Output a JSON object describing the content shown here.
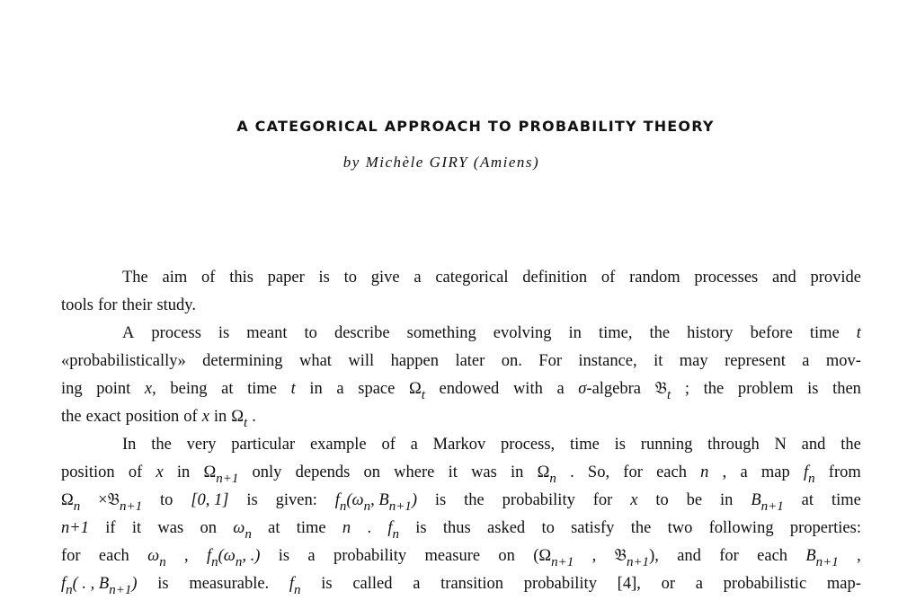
{
  "title": "A CATEGORICAL APPROACH TO PROBABILITY THEORY",
  "author": "by Michèle GIRY (Amiens)",
  "lines": [
    {
      "indent": true,
      "segs": [
        "The aim of this paper is to give a categorical definition of random processes and provide"
      ]
    },
    {
      "last": true,
      "segs": [
        "tools for their study."
      ]
    },
    {
      "indent": true,
      "segs": [
        "A process is meant to describe something evolving in time, the history before time ",
        [
          "i",
          "t"
        ]
      ]
    },
    {
      "segs": [
        "«probabilistically» determining what will happen later on. For instance, it may represent a mov-"
      ]
    },
    {
      "segs": [
        "ing point ",
        [
          "i",
          "x"
        ],
        ", being at time ",
        [
          "i",
          "t"
        ],
        " in a space Ω",
        [
          "s",
          "t"
        ],
        " endowed with a ",
        [
          "i",
          "σ"
        ],
        "-algebra 𝔅",
        [
          "s",
          "t"
        ],
        " ; the problem is then"
      ]
    },
    {
      "last": true,
      "segs": [
        "the exact position of ",
        [
          "i",
          "x"
        ],
        " in Ω",
        [
          "s",
          "t"
        ],
        " ."
      ]
    },
    {
      "indent": true,
      "segs": [
        "In the very particular example of a Markov process, time is running through N and the"
      ]
    },
    {
      "segs": [
        "position of ",
        [
          "i",
          "x"
        ],
        " in Ω",
        [
          "s",
          "n+1"
        ],
        " only depends on where it was in Ω",
        [
          "s",
          "n"
        ],
        " . So, for each ",
        [
          "i",
          "n"
        ],
        " , a map ",
        [
          "i",
          "f"
        ],
        [
          "s",
          "n"
        ],
        " from"
      ]
    },
    {
      "segs": [
        "Ω",
        [
          "s",
          "n"
        ],
        " ×𝔅",
        [
          "s",
          "n+1"
        ],
        " to ",
        [
          "i",
          "[0, 1]"
        ],
        " is given: ",
        [
          "i",
          "f"
        ],
        [
          "s",
          "n"
        ],
        [
          "i",
          "(ω"
        ],
        [
          "s",
          "n"
        ],
        [
          "i",
          ", B"
        ],
        [
          "s",
          "n+1"
        ],
        [
          "i",
          ")"
        ],
        " is the probability for ",
        [
          "i",
          "x"
        ],
        " to be in ",
        [
          "i",
          "B"
        ],
        [
          "s",
          "n+1"
        ],
        " at time"
      ]
    },
    {
      "segs": [
        [
          "i",
          "n+1"
        ],
        " if it was on ",
        [
          "i",
          "ω"
        ],
        [
          "s",
          "n"
        ],
        " at time ",
        [
          "i",
          "n"
        ],
        " . ",
        [
          "i",
          "f"
        ],
        [
          "s",
          "n"
        ],
        " is thus asked to satisfy the two following properties:"
      ]
    },
    {
      "segs": [
        "for each ",
        [
          "i",
          "ω"
        ],
        [
          "s",
          "n"
        ],
        " , ",
        [
          "i",
          "f"
        ],
        [
          "s",
          "n"
        ],
        [
          "i",
          "(ω"
        ],
        [
          "s",
          "n"
        ],
        [
          "i",
          ", .)"
        ],
        " is a probability measure on (Ω",
        [
          "s",
          "n+1"
        ],
        " , 𝔅",
        [
          "s",
          "n+1"
        ],
        "), and for each ",
        [
          "i",
          "B"
        ],
        [
          "s",
          "n+1"
        ],
        " ,"
      ]
    },
    {
      "segs": [
        [
          "i",
          "f"
        ],
        [
          "s",
          "n"
        ],
        [
          "i",
          "( . , B"
        ],
        [
          "s",
          "n+1"
        ],
        [
          "i",
          ")"
        ],
        " is measurable. ",
        [
          "i",
          "f"
        ],
        [
          "s",
          "n"
        ],
        " is called a transition probability [4], or a probabilistic map-"
      ]
    }
  ]
}
